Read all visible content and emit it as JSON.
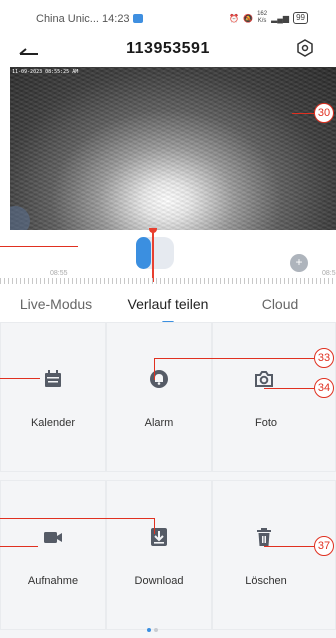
{
  "status_bar": {
    "carrier_time": "China Unic... 14:23",
    "speed_value": "162",
    "speed_unit": "K/s",
    "battery": "99"
  },
  "header": {
    "title": "113953591"
  },
  "video": {
    "timestamp": "11-09-2023 08:55:25 AM"
  },
  "timeline": {
    "left_time": "08:55",
    "right_time": "08:5"
  },
  "tabs": [
    {
      "label": "Live-Modus",
      "active": false
    },
    {
      "label": "Verlauf teilen",
      "active": true
    },
    {
      "label": "Cloud",
      "active": false
    }
  ],
  "actions": [
    {
      "label": "Kalender",
      "icon": "calendar-icon"
    },
    {
      "label": "Alarm",
      "icon": "bell-icon"
    },
    {
      "label": "Foto",
      "icon": "camera-icon"
    },
    {
      "label": "Aufnahme",
      "icon": "video-camera-icon"
    },
    {
      "label": "Download",
      "icon": "download-icon"
    },
    {
      "label": "Löschen",
      "icon": "trash-icon"
    }
  ],
  "callouts": [
    "30",
    "33",
    "34",
    "37"
  ],
  "pager": {
    "pages": 2,
    "current": 1
  },
  "colors": {
    "accent": "#3b8fe0",
    "icon": "#555b66",
    "callout": "#e03020",
    "needle": "#e84030"
  }
}
